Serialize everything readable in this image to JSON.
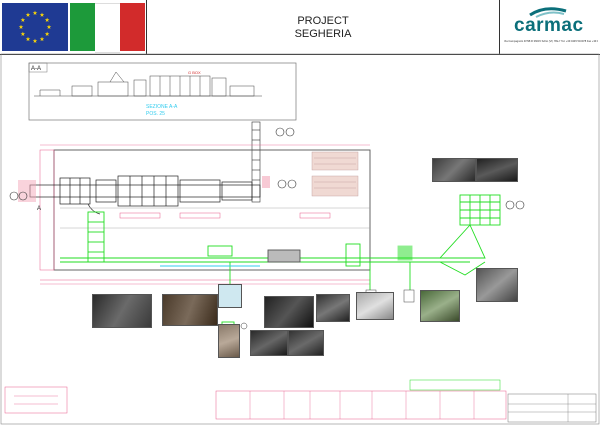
{
  "header": {
    "project_line1": "PROJECT",
    "project_line2": "SEGHERIA",
    "company": "carmac",
    "address": "Via Campagnolo 97/98 R 36015 Schio (VI) ITALY  Tel. +39 0445 516078 Fax +39 0445 516300 info@carmactesy.com"
  },
  "section_view": {
    "label": "A-A",
    "box_label": "G BOX",
    "caption_line1": "SEZIONE A-A",
    "caption_line2": "POS. 25"
  },
  "plan": {
    "marker_a": "A"
  },
  "colors": {
    "eu_blue": "#1f3a93",
    "eu_star": "#f5d20a",
    "it_green": "#1d9a3a",
    "it_white": "#ffffff",
    "it_red": "#d22b2b",
    "conveyor_green": "#22dd22",
    "line_pink": "#e85a8a",
    "cyan": "#33ccee",
    "brand": "#0b6f7a"
  }
}
